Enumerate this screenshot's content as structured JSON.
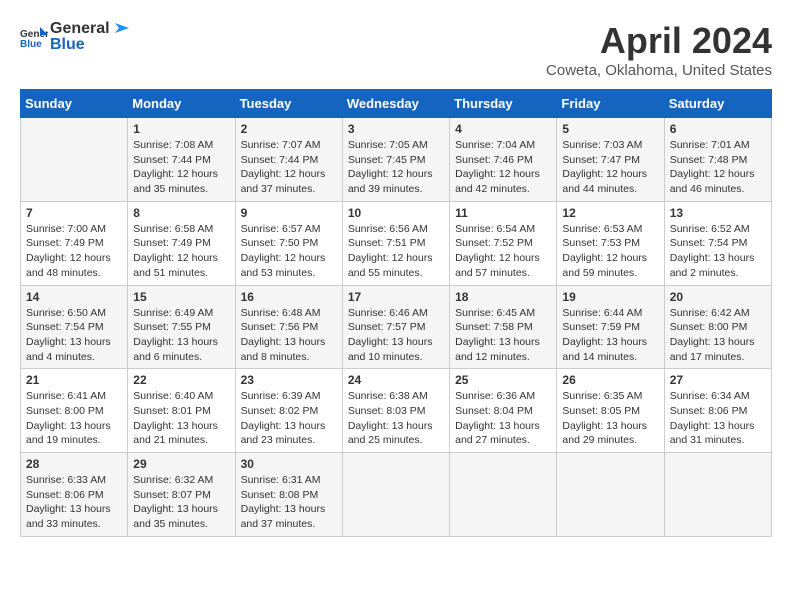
{
  "header": {
    "logo_general": "General",
    "logo_blue": "Blue",
    "title": "April 2024",
    "subtitle": "Coweta, Oklahoma, United States"
  },
  "calendar": {
    "days_of_week": [
      "Sunday",
      "Monday",
      "Tuesday",
      "Wednesday",
      "Thursday",
      "Friday",
      "Saturday"
    ],
    "weeks": [
      [
        {
          "day": "",
          "info": ""
        },
        {
          "day": "1",
          "info": "Sunrise: 7:08 AM\nSunset: 7:44 PM\nDaylight: 12 hours\nand 35 minutes."
        },
        {
          "day": "2",
          "info": "Sunrise: 7:07 AM\nSunset: 7:44 PM\nDaylight: 12 hours\nand 37 minutes."
        },
        {
          "day": "3",
          "info": "Sunrise: 7:05 AM\nSunset: 7:45 PM\nDaylight: 12 hours\nand 39 minutes."
        },
        {
          "day": "4",
          "info": "Sunrise: 7:04 AM\nSunset: 7:46 PM\nDaylight: 12 hours\nand 42 minutes."
        },
        {
          "day": "5",
          "info": "Sunrise: 7:03 AM\nSunset: 7:47 PM\nDaylight: 12 hours\nand 44 minutes."
        },
        {
          "day": "6",
          "info": "Sunrise: 7:01 AM\nSunset: 7:48 PM\nDaylight: 12 hours\nand 46 minutes."
        }
      ],
      [
        {
          "day": "7",
          "info": "Sunrise: 7:00 AM\nSunset: 7:49 PM\nDaylight: 12 hours\nand 48 minutes."
        },
        {
          "day": "8",
          "info": "Sunrise: 6:58 AM\nSunset: 7:49 PM\nDaylight: 12 hours\nand 51 minutes."
        },
        {
          "day": "9",
          "info": "Sunrise: 6:57 AM\nSunset: 7:50 PM\nDaylight: 12 hours\nand 53 minutes."
        },
        {
          "day": "10",
          "info": "Sunrise: 6:56 AM\nSunset: 7:51 PM\nDaylight: 12 hours\nand 55 minutes."
        },
        {
          "day": "11",
          "info": "Sunrise: 6:54 AM\nSunset: 7:52 PM\nDaylight: 12 hours\nand 57 minutes."
        },
        {
          "day": "12",
          "info": "Sunrise: 6:53 AM\nSunset: 7:53 PM\nDaylight: 12 hours\nand 59 minutes."
        },
        {
          "day": "13",
          "info": "Sunrise: 6:52 AM\nSunset: 7:54 PM\nDaylight: 13 hours\nand 2 minutes."
        }
      ],
      [
        {
          "day": "14",
          "info": "Sunrise: 6:50 AM\nSunset: 7:54 PM\nDaylight: 13 hours\nand 4 minutes."
        },
        {
          "day": "15",
          "info": "Sunrise: 6:49 AM\nSunset: 7:55 PM\nDaylight: 13 hours\nand 6 minutes."
        },
        {
          "day": "16",
          "info": "Sunrise: 6:48 AM\nSunset: 7:56 PM\nDaylight: 13 hours\nand 8 minutes."
        },
        {
          "day": "17",
          "info": "Sunrise: 6:46 AM\nSunset: 7:57 PM\nDaylight: 13 hours\nand 10 minutes."
        },
        {
          "day": "18",
          "info": "Sunrise: 6:45 AM\nSunset: 7:58 PM\nDaylight: 13 hours\nand 12 minutes."
        },
        {
          "day": "19",
          "info": "Sunrise: 6:44 AM\nSunset: 7:59 PM\nDaylight: 13 hours\nand 14 minutes."
        },
        {
          "day": "20",
          "info": "Sunrise: 6:42 AM\nSunset: 8:00 PM\nDaylight: 13 hours\nand 17 minutes."
        }
      ],
      [
        {
          "day": "21",
          "info": "Sunrise: 6:41 AM\nSunset: 8:00 PM\nDaylight: 13 hours\nand 19 minutes."
        },
        {
          "day": "22",
          "info": "Sunrise: 6:40 AM\nSunset: 8:01 PM\nDaylight: 13 hours\nand 21 minutes."
        },
        {
          "day": "23",
          "info": "Sunrise: 6:39 AM\nSunset: 8:02 PM\nDaylight: 13 hours\nand 23 minutes."
        },
        {
          "day": "24",
          "info": "Sunrise: 6:38 AM\nSunset: 8:03 PM\nDaylight: 13 hours\nand 25 minutes."
        },
        {
          "day": "25",
          "info": "Sunrise: 6:36 AM\nSunset: 8:04 PM\nDaylight: 13 hours\nand 27 minutes."
        },
        {
          "day": "26",
          "info": "Sunrise: 6:35 AM\nSunset: 8:05 PM\nDaylight: 13 hours\nand 29 minutes."
        },
        {
          "day": "27",
          "info": "Sunrise: 6:34 AM\nSunset: 8:06 PM\nDaylight: 13 hours\nand 31 minutes."
        }
      ],
      [
        {
          "day": "28",
          "info": "Sunrise: 6:33 AM\nSunset: 8:06 PM\nDaylight: 13 hours\nand 33 minutes."
        },
        {
          "day": "29",
          "info": "Sunrise: 6:32 AM\nSunset: 8:07 PM\nDaylight: 13 hours\nand 35 minutes."
        },
        {
          "day": "30",
          "info": "Sunrise: 6:31 AM\nSunset: 8:08 PM\nDaylight: 13 hours\nand 37 minutes."
        },
        {
          "day": "",
          "info": ""
        },
        {
          "day": "",
          "info": ""
        },
        {
          "day": "",
          "info": ""
        },
        {
          "day": "",
          "info": ""
        }
      ]
    ]
  }
}
